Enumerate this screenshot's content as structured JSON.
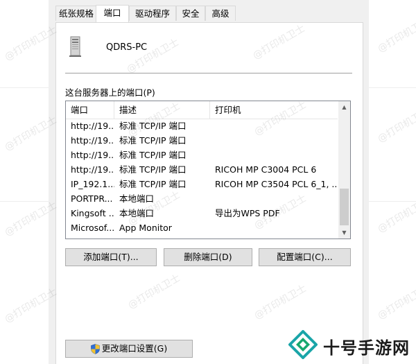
{
  "tabs": [
    {
      "label": "纸张规格"
    },
    {
      "label": "端口"
    },
    {
      "label": "驱动程序"
    },
    {
      "label": "安全"
    },
    {
      "label": "高级"
    }
  ],
  "server": {
    "name": "QDRS-PC"
  },
  "ports_label": "这台服务器上的端口(P)",
  "table": {
    "headers": [
      "端口",
      "描述",
      "打印机"
    ],
    "rows": [
      [
        "http://19...",
        "标准 TCP/IP 端口",
        ""
      ],
      [
        "http://19...",
        "标准 TCP/IP 端口",
        ""
      ],
      [
        "http://19...",
        "标准 TCP/IP 端口",
        ""
      ],
      [
        "http://19...",
        "标准 TCP/IP 端口",
        "RICOH MP C3004 PCL 6"
      ],
      [
        "IP_192.1...",
        "标准 TCP/IP 端口",
        "RICOH MP C3504 PCL 6_1, ..."
      ],
      [
        "PORTPR...",
        "本地端口",
        ""
      ],
      [
        "Kingsoft ...",
        "本地端口",
        "导出为WPS PDF"
      ],
      [
        "Microsof...",
        "App Monitor",
        ""
      ]
    ]
  },
  "buttons": {
    "add": "添加端口(T)...",
    "delete": "删除端口(D)",
    "configure": "配置端口(C)...",
    "change_settings": "更改端口设置(G)"
  },
  "watermark_text": "@打印机卫士",
  "brand": {
    "name": "十号手游网"
  },
  "colors": {
    "brand_green": "#17a86e",
    "brand_teal": "#1aa5a8"
  }
}
